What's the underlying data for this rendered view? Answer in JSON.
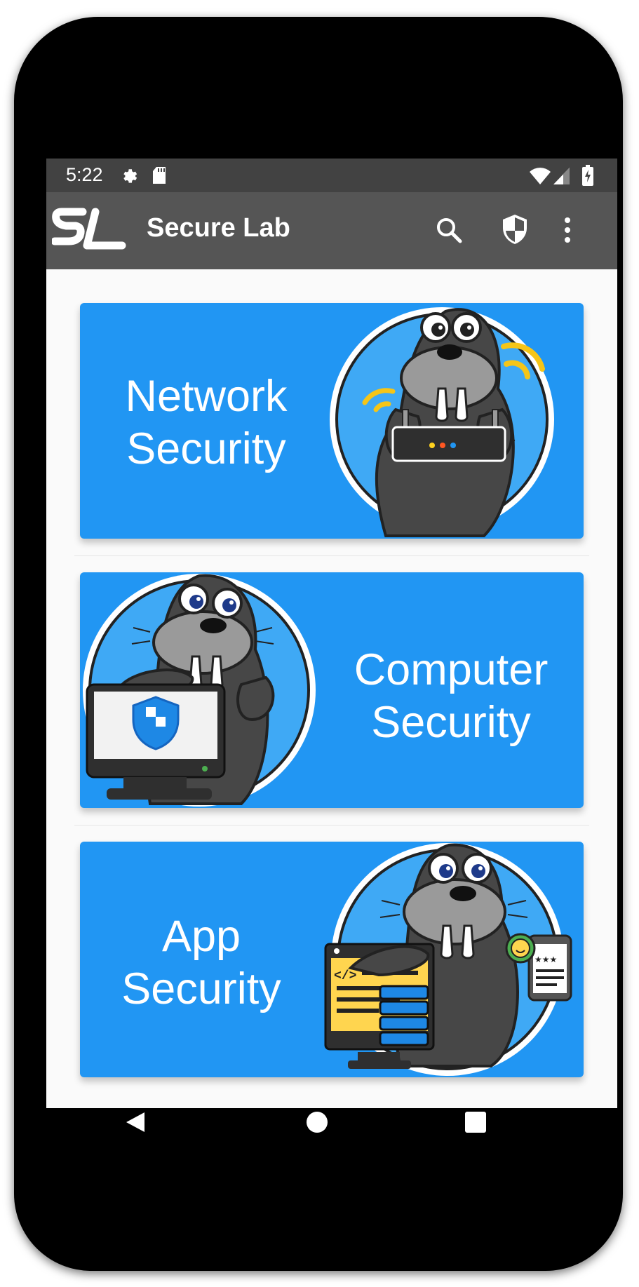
{
  "status_bar": {
    "time": "5:22",
    "icons": [
      "settings-icon",
      "sd-card-icon",
      "wifi-icon",
      "signal-icon",
      "battery-charging-icon"
    ]
  },
  "app_bar": {
    "logo": "SL",
    "title": "Secure Lab",
    "actions": [
      "search-icon",
      "shield-icon",
      "more-vert-icon"
    ]
  },
  "cards": [
    {
      "line1": "Network",
      "line2": "Security",
      "illustration": "walrus-with-router"
    },
    {
      "line1": "Computer",
      "line2": "Security",
      "illustration": "walrus-with-monitor"
    },
    {
      "line1": "App",
      "line2": "Security",
      "illustration": "walrus-with-code-window-and-phone"
    }
  ],
  "nav_bar": [
    "back-icon",
    "home-icon",
    "recents-icon"
  ],
  "colors": {
    "card": "#2196f3",
    "app_bar": "#555555",
    "status_bar": "#424242",
    "circle": "#3fa9f5",
    "walrus": "#4a4a4a"
  }
}
